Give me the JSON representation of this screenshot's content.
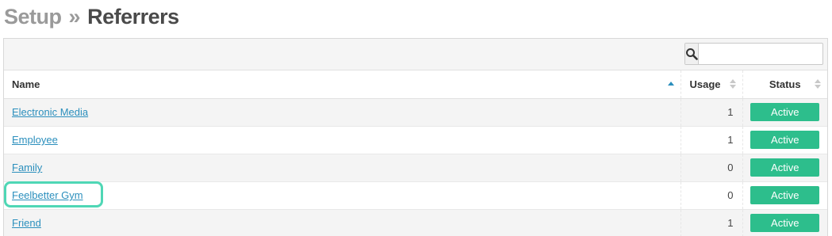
{
  "page": {
    "breadcrumb_parent": "Setup",
    "breadcrumb_separator": "»",
    "title": "Referrers"
  },
  "search": {
    "placeholder": "",
    "value": ""
  },
  "table": {
    "columns": {
      "name": "Name",
      "usage": "Usage",
      "status": "Status"
    },
    "sort": {
      "column": "Name",
      "direction": "ascending"
    },
    "rows": [
      {
        "name": "Electronic Media",
        "usage": "1",
        "status": "Active"
      },
      {
        "name": "Employee",
        "usage": "1",
        "status": "Active"
      },
      {
        "name": "Family",
        "usage": "0",
        "status": "Active"
      },
      {
        "name": "Feelbetter Gym",
        "usage": "0",
        "status": "Active"
      },
      {
        "name": "Friend",
        "usage": "1",
        "status": "Active"
      }
    ]
  },
  "colors": {
    "link": "#2b8fbd",
    "status_active": "#2dbe8c",
    "sort_active": "#2b8fbd",
    "highlight": "#4fd7b5"
  },
  "icons": {
    "search": "search-icon",
    "sort_asc": "sort-asc-icon",
    "sort_both": "sort-icon"
  }
}
